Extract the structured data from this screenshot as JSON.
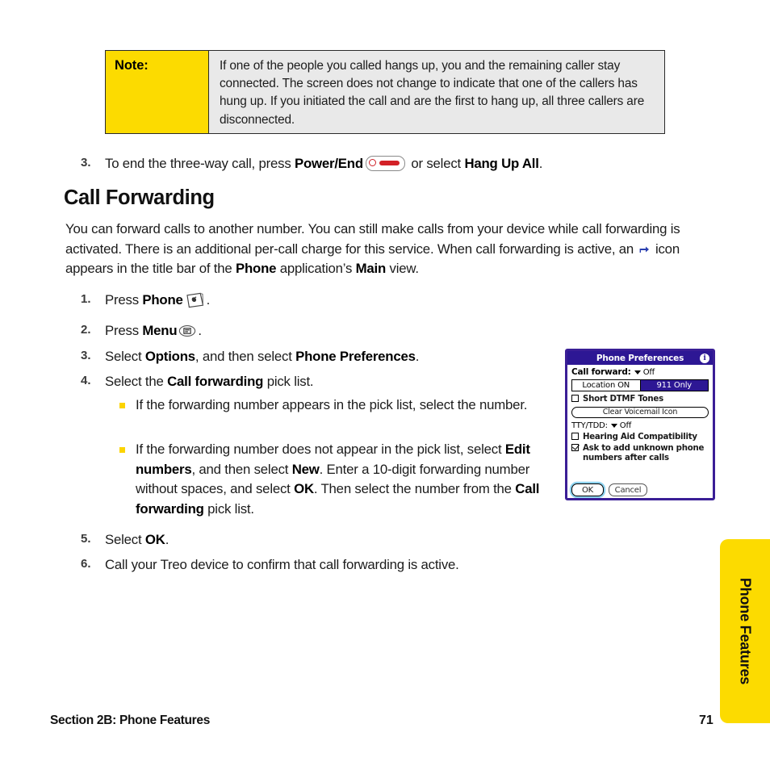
{
  "note": {
    "label": "Note:",
    "body": "If one of the people you called hangs up, you and the remaining caller stay connected. The screen does not change to indicate that one of the callers has hung up. If you initiated the call and are the first to hang up, all three callers are disconnected.",
    "label_bg": "#fcdb00",
    "body_bg": "#e9e9e9"
  },
  "step3_prev": {
    "num": "3.",
    "pre": "To end the three-way call, press ",
    "bold1": "Power/End",
    "mid": " or select ",
    "bold2": "Hang Up All",
    "end": ".",
    "icon": "power-end-button-icon"
  },
  "heading": "Call Forwarding",
  "intro": {
    "p1": "You can forward calls to another number. You can still make calls from your device while call forwarding is activated. There is an additional per-call charge for this service. When call forwarding is active, an ",
    "p2": " icon appears in the title bar of the ",
    "bold_phone": "Phone",
    "p3": " application’s ",
    "bold_main": "Main",
    "p4": " view.",
    "icon": "call-forward-arrow-icon"
  },
  "steps": [
    {
      "num": "1.",
      "pre": "Press ",
      "bold": "Phone",
      "post": ".",
      "icon": "phone-hardware-button-icon"
    },
    {
      "num": "2.",
      "pre": "Press ",
      "bold": "Menu",
      "post": ".",
      "icon": "menu-hardware-button-icon"
    },
    {
      "num": "3.",
      "pre": "Select ",
      "bold": "Options",
      "mid": ", and then select ",
      "bold2": "Phone Preferences",
      "post": "."
    },
    {
      "num": "4.",
      "pre": "Select the ",
      "bold": "Call forwarding",
      "post": " pick list."
    },
    {
      "num": "5.",
      "pre": "Select ",
      "bold": "OK",
      "post": "."
    },
    {
      "num": "6.",
      "pre": "Call your Treo device to confirm that call forwarding is active."
    }
  ],
  "bullets": [
    {
      "text": "If the forwarding number appears in the pick list, select the number."
    },
    {
      "t1": "If the forwarding number does not appear in the pick list, select ",
      "b1": "Edit numbers",
      "t2": ", and then select ",
      "b2": "New",
      "t3": ". Enter a 10-digit forwarding number without spaces, and select ",
      "b3": "OK",
      "t4": ". Then select the number from the ",
      "b4": "Call forwarding",
      "t5": " pick list."
    }
  ],
  "device": {
    "title": "Phone Preferences",
    "info_icon_glyph": "i",
    "call_forward_label": "Call forward:",
    "call_forward_value": "Off",
    "location_off_label": "Location ON",
    "location_on_label": "911 Only",
    "short_dtmf_label": "Short DTMF Tones",
    "short_dtmf_checked": false,
    "clear_voicemail_label": "Clear Voicemail Icon",
    "tty_label": "TTY/TDD:",
    "tty_value": "Off",
    "hearing_aid_label": "Hearing Aid Compatibility",
    "hearing_aid_checked": false,
    "ask_add_label": "Ask to add unknown phone numbers after calls",
    "ask_add_checked": true,
    "ok_label": "OK",
    "cancel_label": "Cancel",
    "title_bg": "#2d1794",
    "frame_color": "#3a1e96"
  },
  "side_tab": {
    "label": "Phone Features",
    "color": "#fcdb00"
  },
  "footer": {
    "left": "Section 2B: Phone Features",
    "page": "71"
  }
}
